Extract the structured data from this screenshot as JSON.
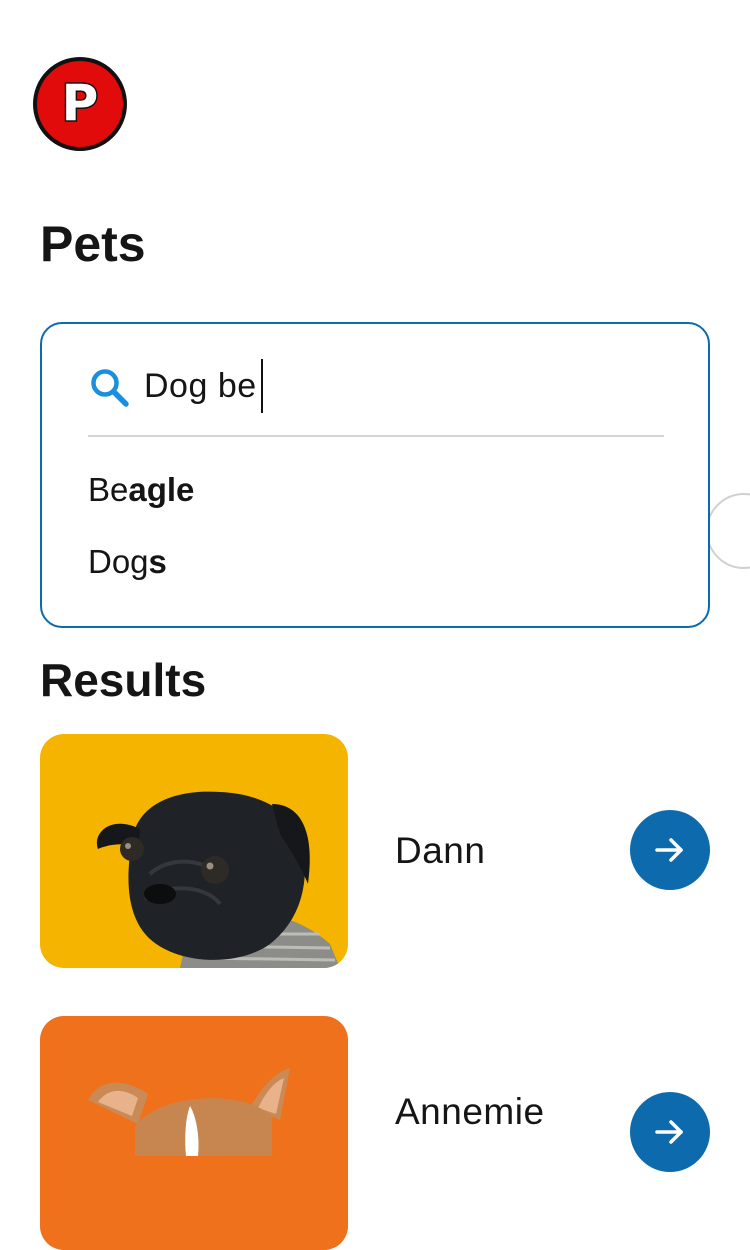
{
  "app": {
    "logo_letter": "P",
    "logo_color": "#e10b0b"
  },
  "page": {
    "title": "Pets"
  },
  "search": {
    "value": "Dog be",
    "icon": "search-icon",
    "accent_color": "#0d6aad",
    "suggestions": [
      {
        "typed": "Be",
        "completion": "agle"
      },
      {
        "typed": "Dog",
        "completion": "s"
      }
    ]
  },
  "results": {
    "title": "Results",
    "items": [
      {
        "name": "Dann",
        "photo": "black pug on yellow background",
        "photo_bg": "#f5b400",
        "action_icon": "arrow-right-icon"
      },
      {
        "name": "Annemie",
        "photo": "fawn dog on orange background",
        "photo_bg": "#ee6a1a",
        "action_icon": "arrow-right-icon"
      }
    ]
  }
}
